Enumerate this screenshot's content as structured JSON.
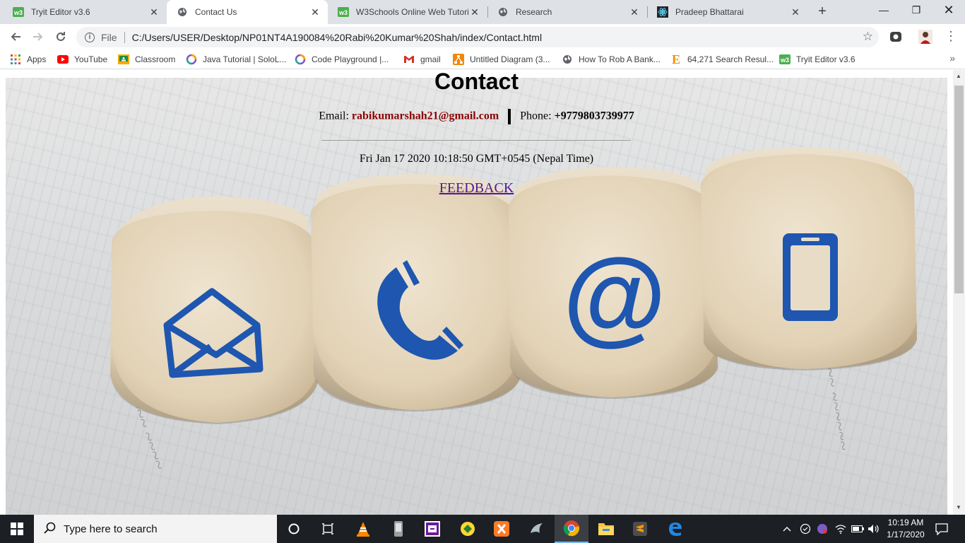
{
  "browser": {
    "tabs": [
      {
        "title": "Tryit Editor v3.6",
        "icon": "w3schools-icon",
        "active": false
      },
      {
        "title": "Contact Us",
        "icon": "globe-icon",
        "active": true
      },
      {
        "title": "W3Schools Online Web Tutoria",
        "icon": "w3schools-icon",
        "active": false
      },
      {
        "title": "Research",
        "icon": "globe-icon",
        "active": false
      },
      {
        "title": "Pradeep Bhattarai",
        "icon": "react-icon",
        "active": false
      }
    ],
    "address": {
      "scheme": "File",
      "url": "C:/Users/USER/Desktop/NP01NT4A190084%20Rabi%20Kumar%20Shah/index/Contact.html"
    },
    "bookmarks": [
      {
        "label": "Apps",
        "icon": "apps-grid-icon"
      },
      {
        "label": "YouTube",
        "icon": "youtube-icon"
      },
      {
        "label": "Classroom",
        "icon": "classroom-icon"
      },
      {
        "label": "Java Tutorial | SoloL...",
        "icon": "sololearn-icon"
      },
      {
        "label": "Code Playground |...",
        "icon": "sololearn-icon"
      },
      {
        "label": "gmail",
        "icon": "gmail-icon"
      },
      {
        "label": "Untitled Diagram (3...",
        "icon": "drawio-icon"
      },
      {
        "label": "How To Rob A Bank...",
        "icon": "globe-icon"
      },
      {
        "label": "64,271 Search Resul...",
        "icon": "e-icon"
      },
      {
        "label": "Tryit Editor v3.6",
        "icon": "w3schools-icon"
      }
    ]
  },
  "page": {
    "heading": "Contact",
    "email_label": "Email:",
    "email_value": "rabikumarshah21@gmail.com",
    "phone_label": "Phone:",
    "phone_value": "+9779803739977",
    "datetime": "Fri Jan 17 2020 10:18:50 GMT+0545 (Nepal Time)",
    "feedback_link": "FEEDBACK"
  },
  "taskbar": {
    "search_placeholder": "Type here to search",
    "time": "10:19 AM",
    "date": "1/17/2020"
  },
  "colors": {
    "email": "#8b0000",
    "link_visited": "#551a8b",
    "dice_icon": "#1e56b0",
    "taskbar": "#1c1f23"
  }
}
